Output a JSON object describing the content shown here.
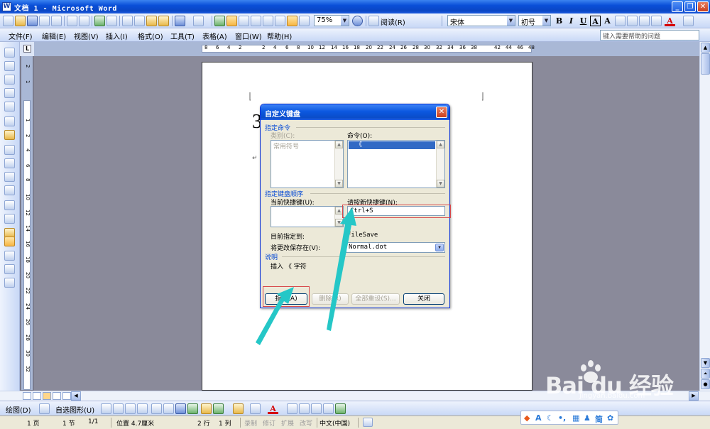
{
  "window": {
    "title": "文档 1 - Microsoft Word",
    "icon_letter": "W"
  },
  "toolbar": {
    "zoom": "75%",
    "read_label": "阅读(R)",
    "font_name": "宋体",
    "font_size": "初号",
    "bold": "B",
    "italic": "I",
    "underline": "U",
    "border_a": "A",
    "scale_a": "A",
    "font_color": "A"
  },
  "menu": {
    "items": [
      "文件(F)",
      "编辑(E)",
      "视图(V)",
      "插入(I)",
      "格式(O)",
      "工具(T)",
      "表格(A)",
      "窗口(W)",
      "帮助(H)"
    ],
    "help_placeholder": "键入需要帮助的问题"
  },
  "ruler": {
    "tab_selector": "L",
    "h_numbers": [
      "8",
      "6",
      "4",
      "2",
      "",
      "2",
      "4",
      "6",
      "8",
      "10",
      "12",
      "14",
      "16",
      "18",
      "20",
      "22",
      "24",
      "26",
      "28",
      "30",
      "32",
      "34",
      "36",
      "38",
      "",
      "42",
      "44",
      "46",
      "48"
    ],
    "v_numbers": [
      "2",
      "1",
      "",
      "1",
      "2",
      "4",
      "6",
      "8",
      "10",
      "12",
      "14",
      "16",
      "18",
      "20",
      "22",
      "24",
      "26",
      "28",
      "30",
      "32"
    ]
  },
  "document": {
    "big_char": "3",
    "paragraph_mark": "↵"
  },
  "dialog": {
    "title": "自定义键盘",
    "group_command": "指定命令",
    "category_label": "类别(C):",
    "category_items": [
      "常用符号"
    ],
    "command_label": "命令(O):",
    "command_items": [
      "《"
    ],
    "group_keys": "指定键盘顺序",
    "current_keys_label": "当前快捷键(U):",
    "new_key_label": "请按新快捷键(N):",
    "new_key_value": "Ctrl+S",
    "assigned_to_label": "目前指定到:",
    "assigned_to_value": "FileSave",
    "save_in_label": "将更改保存在(V):",
    "save_in_value": "Normal.dot",
    "group_description": "说明",
    "description_text": "插入 《 字符",
    "buttons": {
      "assign": "指定(A)",
      "remove": "删除(R)",
      "reset_all": "全部重设(S)...",
      "close": "关闭"
    }
  },
  "draw_toolbar": {
    "draw_label": "绘图(D)",
    "autoshapes_label": "自选图形(U)"
  },
  "status": {
    "page": "1 页",
    "section": "1 节",
    "page_of": "1/1",
    "position": "位置 4.7厘米",
    "line": "2 行",
    "column": "1 列",
    "rec": "录制",
    "trk": "修订",
    "ext": "扩展",
    "ovr": "改写",
    "language": "中文(中国)"
  },
  "ime": {
    "mode_text": "简"
  },
  "watermark": {
    "brand": "Bai du 经验",
    "url": "jingyan.baidu.com"
  },
  "colors": {
    "xp_blue": "#0a4fd8",
    "dialog_bg": "#ece9d8",
    "highlight": "#316ac5",
    "annotation_arrow": "#25c7c7",
    "annotation_box": "#d7474a"
  }
}
